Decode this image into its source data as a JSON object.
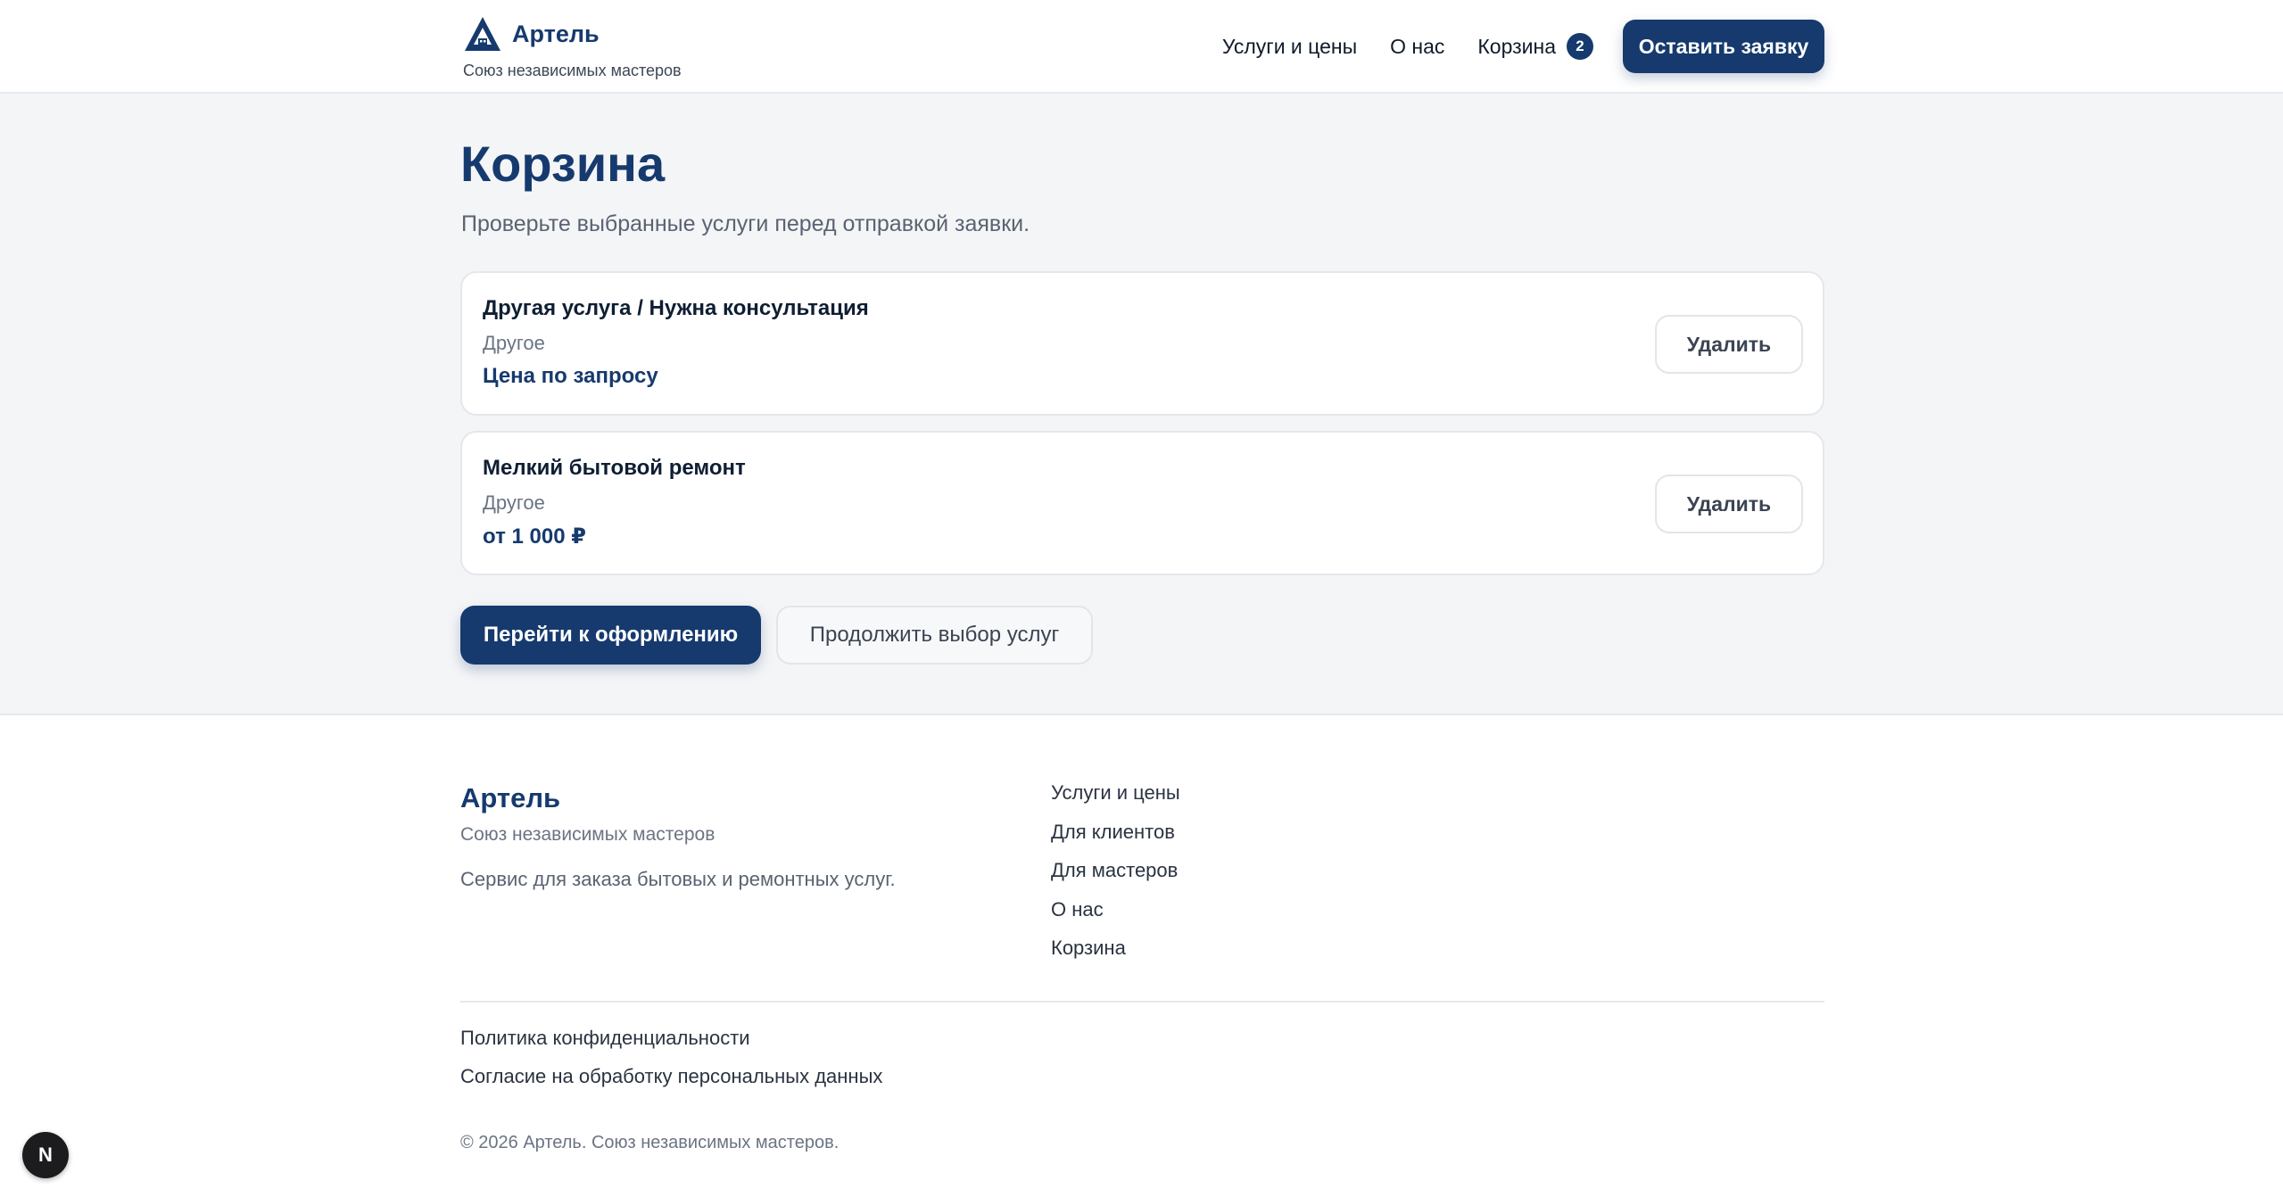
{
  "header": {
    "brand_name": "Артель",
    "brand_sub": "Союз независимых мастеров",
    "nav": {
      "services": "Услуги и цены",
      "about": "О нас",
      "cart": "Корзина",
      "cart_count": "2"
    },
    "cta_label": "Оставить заявку",
    "logo_icon": "triangle-house-logo-icon"
  },
  "main": {
    "title": "Корзина",
    "subtitle": "Проверьте выбранные услуги перед отправкой заявки.",
    "items": [
      {
        "title": "Другая услуга / Нужна консультация",
        "category": "Другое",
        "price": "Цена по запросу",
        "delete_label": "Удалить"
      },
      {
        "title": "Мелкий бытовой ремонт",
        "category": "Другое",
        "price": "от 1 000 ₽",
        "delete_label": "Удалить"
      }
    ],
    "checkout_label": "Перейти к оформлению",
    "continue_label": "Продолжить выбор услуг"
  },
  "footer": {
    "brand_name": "Артель",
    "brand_sub": "Союз независимых мастеров",
    "description": "Сервис для заказа бытовых и ремонтных услуг.",
    "links": [
      "Услуги и цены",
      "Для клиентов",
      "Для мастеров",
      "О нас",
      "Корзина"
    ],
    "privacy": "Политика конфиденциальности",
    "consent": "Согласие на обработку персональных данных",
    "copyright": "© 2026 Артель. Союз независимых мастеров."
  },
  "dev_badge": {
    "letter": "N",
    "icon": "nextjs-dev-icon"
  },
  "colors": {
    "brand": "#163a6e",
    "background": "#f4f5f7"
  }
}
